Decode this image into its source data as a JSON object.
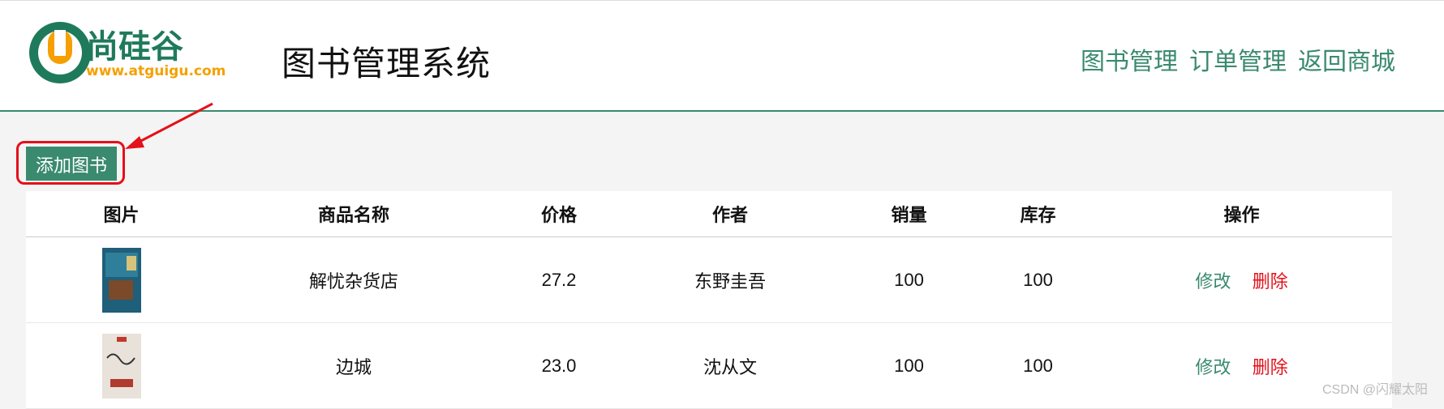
{
  "header": {
    "logo_text": "尚硅谷",
    "logo_url_text": "www.atguigu.com",
    "system_title": "图书管理系统",
    "nav": [
      {
        "label": "图书管理"
      },
      {
        "label": "订单管理"
      },
      {
        "label": "返回商城"
      }
    ]
  },
  "toolbar": {
    "add_book_label": "添加图书"
  },
  "table": {
    "columns": [
      "图片",
      "商品名称",
      "价格",
      "作者",
      "销量",
      "库存",
      "操作"
    ],
    "rows": [
      {
        "name": "解忧杂货店",
        "price": "27.2",
        "author": "东野圭吾",
        "sales": "100",
        "stock": "100",
        "edit": "修改",
        "delete": "删除"
      },
      {
        "name": "边城",
        "price": "23.0",
        "author": "沈从文",
        "sales": "100",
        "stock": "100",
        "edit": "修改",
        "delete": "删除"
      }
    ]
  },
  "watermark": "CSDN @闪耀太阳",
  "colors": {
    "brand_green": "#3a8a6f",
    "danger_red": "#e4101a",
    "logo_orange": "#f5a000"
  }
}
